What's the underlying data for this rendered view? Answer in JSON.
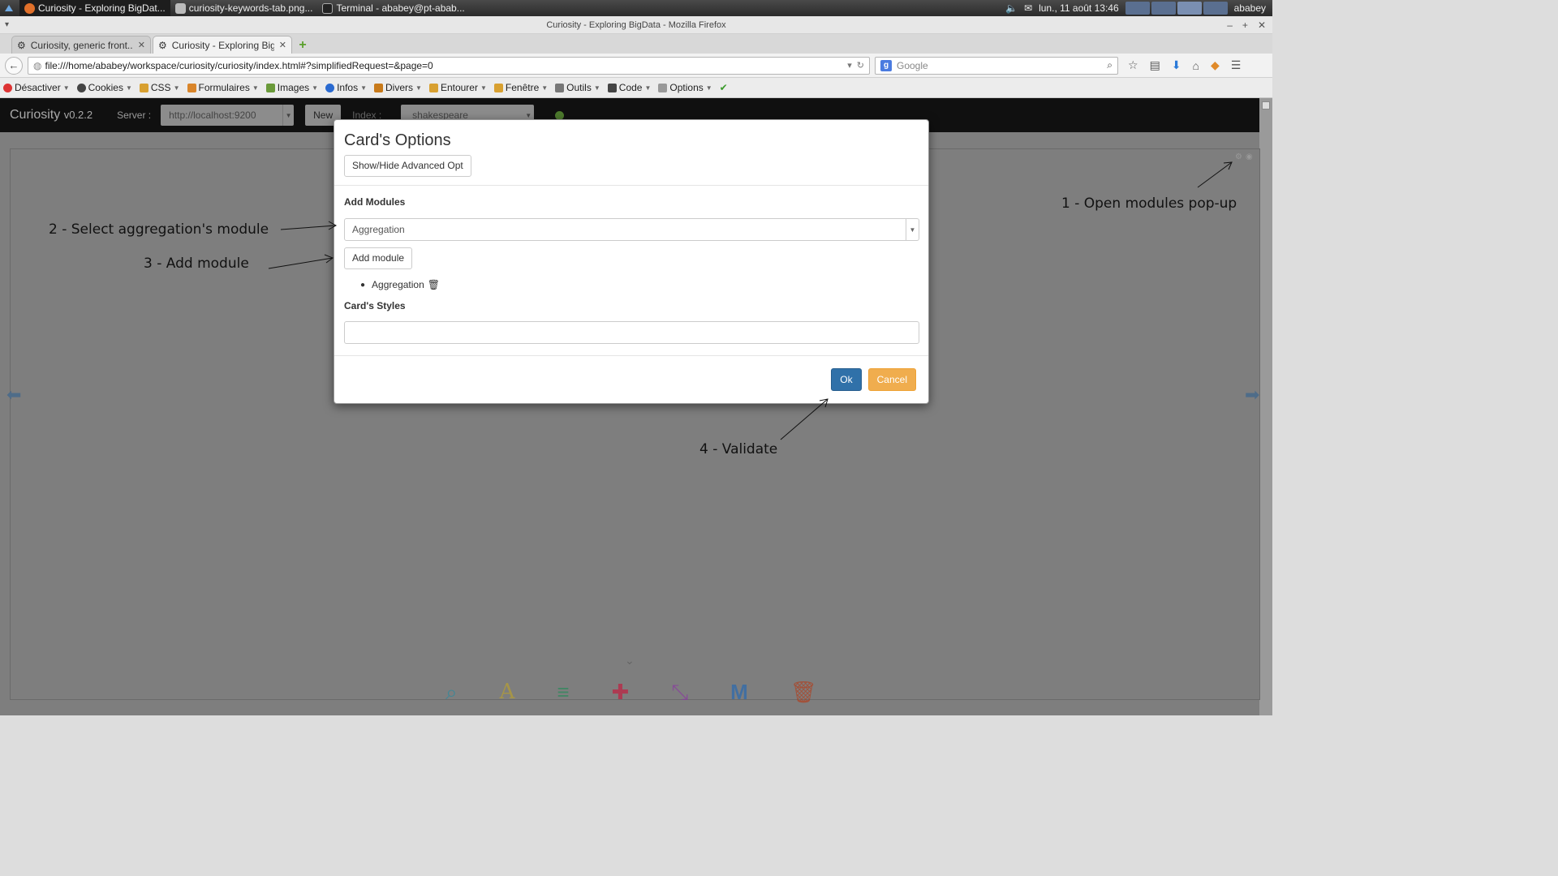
{
  "taskbar": {
    "tasks": [
      {
        "label": "Curiosity - Exploring BigDat..."
      },
      {
        "label": "curiosity-keywords-tab.png..."
      },
      {
        "label": "Terminal - ababey@pt-abab..."
      }
    ],
    "datetime": "lun., 11 août  13:46",
    "user": "ababey"
  },
  "window": {
    "title": "Curiosity - Exploring BigData - Mozilla Firefox"
  },
  "tabs": [
    {
      "label": "Curiosity, generic front..."
    },
    {
      "label": "Curiosity - Exploring Big..."
    }
  ],
  "nav": {
    "url": "file:///home/ababey/workspace/curiosity/curiosity/index.html#?simplifiedRequest=&page=0",
    "search_placeholder": "Google"
  },
  "devbar": {
    "items": [
      "Désactiver",
      "Cookies",
      "CSS",
      "Formulaires",
      "Images",
      "Infos",
      "Divers",
      "Entourer",
      "Fenêtre",
      "Outils",
      "Code",
      "Options"
    ]
  },
  "app": {
    "name": "Curiosity",
    "version": "v0.2.2",
    "server_label": "Server :",
    "server_value": "http://localhost:9200",
    "new_label": "New",
    "index_label": "Index :",
    "index_value": "shakespeare"
  },
  "modal": {
    "title": "Card's Options",
    "advanced_button": "Show/Hide Advanced Opt",
    "add_modules_label": "Add Modules",
    "module_select_value": "Aggregation",
    "add_module_button": "Add module",
    "modules": [
      {
        "name": "Aggregation"
      }
    ],
    "styles_label": "Card's Styles",
    "styles_value": "",
    "ok_label": "Ok",
    "cancel_label": "Cancel"
  },
  "annotations": {
    "step1": "1 - Open modules pop-up",
    "step2": "2 - Select aggregation's module",
    "step3": "3 - Add module",
    "step4": "4 - Validate"
  },
  "colors": {
    "primary": "#3071a9",
    "warning": "#f0ad4e",
    "appbar": "#101010",
    "overlay": "#7e7e7e"
  }
}
